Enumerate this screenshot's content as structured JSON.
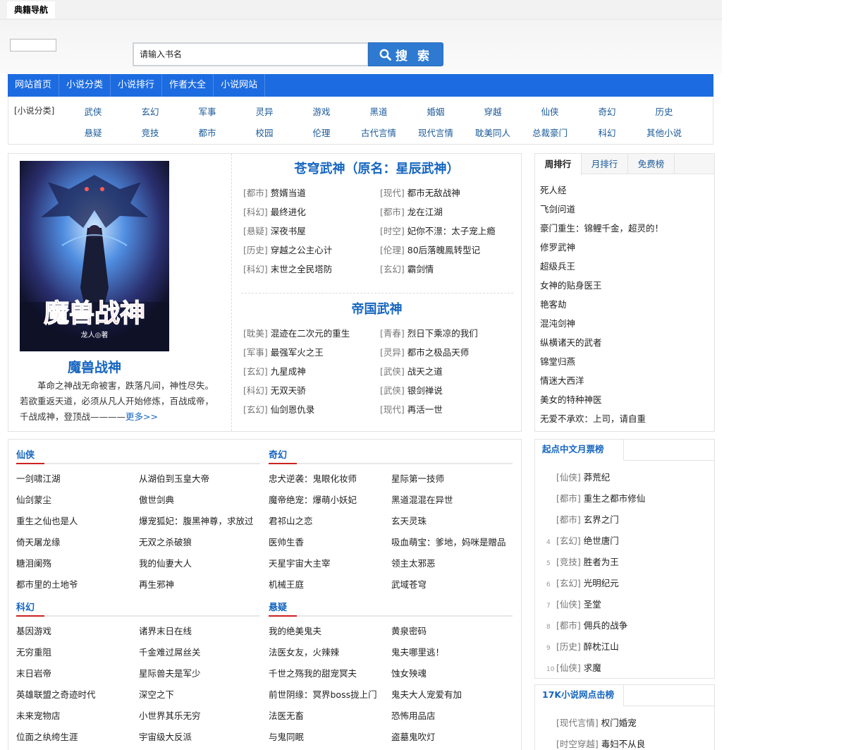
{
  "site": {
    "brand": "典籍导航"
  },
  "search": {
    "placeholder": "请输入书名",
    "button": "搜 索"
  },
  "nav": [
    "网站首页",
    "小说分类",
    "小说排行",
    "作者大全",
    "小说网站"
  ],
  "categories": {
    "label": "[小说分类]",
    "row1": [
      "武侠",
      "玄幻",
      "军事",
      "灵异",
      "游戏",
      "黑道",
      "婚姻",
      "穿越",
      "仙侠",
      "奇幻",
      "历史"
    ],
    "row2": [
      "悬疑",
      "竞技",
      "都市",
      "校园",
      "伦理",
      "古代言情",
      "现代言情",
      "耽美同人",
      "总裁豪门",
      "科幻",
      "其他小说"
    ]
  },
  "featured": {
    "cover_title": "魔兽战神",
    "cover_author": "龙人◎著",
    "title": "魔兽战神",
    "desc": "革命之神战无命被害，跌落凡间，神性尽失。若欲重返天道，必须从凡人开始修炼，百战成帝，千战成神，登顶战————",
    "more": "更多>>",
    "book1": {
      "title": "苍穹武神（原名：星辰武神）",
      "items": [
        {
          "tag": "[都市]",
          "name": "赘婿当道"
        },
        {
          "tag": "[现代]",
          "name": "都市无敌战神"
        },
        {
          "tag": "[科幻]",
          "name": "最终进化"
        },
        {
          "tag": "[都市]",
          "name": "龙在江湖"
        },
        {
          "tag": "[悬疑]",
          "name": "深夜书屋"
        },
        {
          "tag": "[时空]",
          "name": "妃你不澋：太子宠上瘾"
        },
        {
          "tag": "[历史]",
          "name": "穿越之公主心计"
        },
        {
          "tag": "[伦理]",
          "name": "80后落魄鳯转型记"
        },
        {
          "tag": "[科幻]",
          "name": "末世之全民塔防"
        },
        {
          "tag": "[玄幻]",
          "name": "霸剑情"
        }
      ]
    },
    "book2": {
      "title": "帝国武神",
      "items": [
        {
          "tag": "[耽美]",
          "name": "混迹在二次元的重生"
        },
        {
          "tag": "[青春]",
          "name": "烈日下乘凉的我们"
        },
        {
          "tag": "[军事]",
          "name": "最强军火之王"
        },
        {
          "tag": "[灵异]",
          "name": "都市之极品天师"
        },
        {
          "tag": "[玄幻]",
          "name": "九星成神"
        },
        {
          "tag": "[武侠]",
          "name": "战天之道"
        },
        {
          "tag": "[科幻]",
          "name": "无双天骄"
        },
        {
          "tag": "[武侠]",
          "name": "银剑禅说"
        },
        {
          "tag": "[玄幻]",
          "name": "仙剑恩仇录"
        },
        {
          "tag": "[现代]",
          "name": "再活一世"
        }
      ]
    }
  },
  "rank": {
    "tabs": [
      "周排行",
      "月排行",
      "免费榜"
    ],
    "items": [
      "死人经",
      "飞剑问道",
      "豪门重生：锦鲤千金，超灵的！",
      "修罗武神",
      "超级兵王",
      "女神的贴身医王",
      "艳客劫",
      "混沌剑神",
      "纵横诸天的武者",
      "锦堂归燕",
      "情迷大西洋",
      "美女的特种神医",
      "无爱不承欢：上司，请自重"
    ]
  },
  "sections": {
    "xianxia": {
      "title": "仙侠",
      "col1": [
        "一剑啸江湖",
        "仙剑蒙尘",
        "重生之仙也是人",
        "倚天屠龙缘",
        "糖泪阑殇",
        "都市里的土地爷"
      ],
      "col2": [
        "从湖伯到玉皇大帝",
        "傲世剑典",
        "爆宠狐妃：腹黑神尊，求放过",
        "无双之杀破狼",
        "我的仙妻大人",
        "再生邪神"
      ]
    },
    "qihuan": {
      "title": "奇幻",
      "col1": [
        "忠犬逆袭：鬼眼化妆师",
        "魔帝绝宠：爆萌小妖妃",
        "君祁山之恋",
        "医帅生香",
        "天星宇宙大主宰",
        "机械王庭"
      ],
      "col2": [
        "星际第一技师",
        "黑道混混在异世",
        "玄天灵珠",
        "吸血萌宝：爹地，妈咪是贈品",
        "领主太邪恶",
        "武域苍穹"
      ]
    },
    "kehuan": {
      "title": "科幻",
      "col1": [
        "基因游戏",
        "无穷重阻",
        "末日岩帝",
        "英雄联盟之奇迹时代",
        "未来宠物店",
        "位面之纨绔生涯"
      ],
      "col2": [
        "诸界末日在线",
        "千金难过屌丝关",
        "星际兽夫是军少",
        "深空之下",
        "小世界其乐无穷",
        "宇宙级大反派"
      ]
    },
    "xuanyi": {
      "title": "悬疑",
      "col1": [
        "我的绝美鬼夫",
        "法医女友，火辣辣",
        "千世之殇我的甜宠冥夫",
        "前世阴缘：冥界boss拢上门",
        "法医无畜",
        "与鬼同眠"
      ],
      "col2": [
        "黄泉密码",
        "鬼夫哪里逃！",
        "蚀女殃魂",
        "鬼夫大人宠爱有加",
        "恐怖用品店",
        "盗墓鬼吹灯"
      ]
    }
  },
  "qidian": {
    "title": "起点中文月票榜",
    "items": [
      {
        "num": "",
        "tag": "[仙侠]",
        "name": "莽荒纪"
      },
      {
        "num": "",
        "tag": "[都市]",
        "name": "重生之都市修仙"
      },
      {
        "num": "",
        "tag": "[都市]",
        "name": "玄界之门"
      },
      {
        "num": "4",
        "tag": "[玄幻]",
        "name": "绝世唐门"
      },
      {
        "num": "5",
        "tag": "[竞技]",
        "name": "胜者为王"
      },
      {
        "num": "6",
        "tag": "[玄幻]",
        "name": "光明纪元"
      },
      {
        "num": "7",
        "tag": "[仙侠]",
        "name": "圣堂"
      },
      {
        "num": "8",
        "tag": "[都市]",
        "name": "佣兵的战争"
      },
      {
        "num": "9",
        "tag": "[历史]",
        "name": "醉枕江山"
      },
      {
        "num": "10",
        "tag": "[仙侠]",
        "name": "求魔"
      }
    ]
  },
  "k17": {
    "title": "17K小说网点击榜",
    "items": [
      {
        "tag": "[现代言情]",
        "name": "权门婚宠"
      },
      {
        "tag": "[时空穿越]",
        "name": "毒妇不从良"
      }
    ]
  }
}
